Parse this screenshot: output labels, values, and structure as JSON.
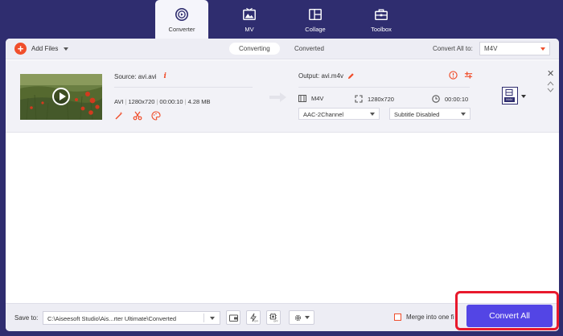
{
  "nav": {
    "tabs": [
      {
        "label": "Converter",
        "icon": "converter-icon",
        "active": true
      },
      {
        "label": "MV",
        "icon": "mv-icon",
        "active": false
      },
      {
        "label": "Collage",
        "icon": "collage-icon",
        "active": false
      },
      {
        "label": "Toolbox",
        "icon": "toolbox-icon",
        "active": false
      }
    ]
  },
  "toolbar": {
    "add_files": "Add Files",
    "tab_converting": "Converting",
    "tab_converted": "Converted",
    "convert_all_label": "Convert All to:",
    "convert_all_value": "M4V"
  },
  "file": {
    "source": "Source: avi.avi",
    "format": "AVI",
    "resolution": "1280x720",
    "duration": "00:00:10",
    "size": "4.28 MB",
    "output": "Output: avi.m4v",
    "out_format": "M4V",
    "out_resolution": "1280x720",
    "out_duration": "00:00:10",
    "audio": "AAC-2Channel",
    "subtitle": "Subtitle Disabled",
    "format_badge": "M4V"
  },
  "bottom": {
    "save_to": "Save to:",
    "path": "C:\\Aiseesoft Studio\\Ais...rter Ultimate\\Converted",
    "merge": "Merge into one fi",
    "convert_all": "Convert All"
  },
  "colors": {
    "nav_bg": "#2f2d6f",
    "accent": "#f04e2b",
    "button": "#5345e5",
    "highlight": "#e8192c"
  }
}
